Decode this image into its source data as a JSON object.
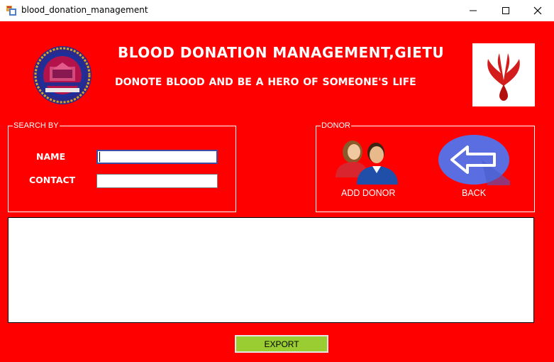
{
  "window": {
    "title": "blood_donation_management",
    "icon": "windows-form-icon",
    "controls": [
      "minimize-icon",
      "maximize-icon",
      "close-icon"
    ]
  },
  "header": {
    "title": "BLOOD DONATION MANAGEMENT,GIETU",
    "subtitle": "DONOTE  BLOOD AND BE A HERO OF SOMEONE'S LIFE",
    "left_logo": "university-seal-logo",
    "right_logo": "blood-drop-hands-logo"
  },
  "search": {
    "legend": "SEARCH BY",
    "name_label": "NAME",
    "name_value": "",
    "contact_label": "CONTACT",
    "contact_value": ""
  },
  "donor": {
    "legend": "DONOR",
    "add_label": "ADD DONOR",
    "add_icon": "people-icon",
    "back_label": "BACK",
    "back_icon": "arrow-left-icon"
  },
  "results": {
    "rows": []
  },
  "footer": {
    "export_label": "EXPORT"
  },
  "colors": {
    "background": "#ff0000",
    "export_button": "#9acd32",
    "back_button": "#5b6ee1"
  }
}
